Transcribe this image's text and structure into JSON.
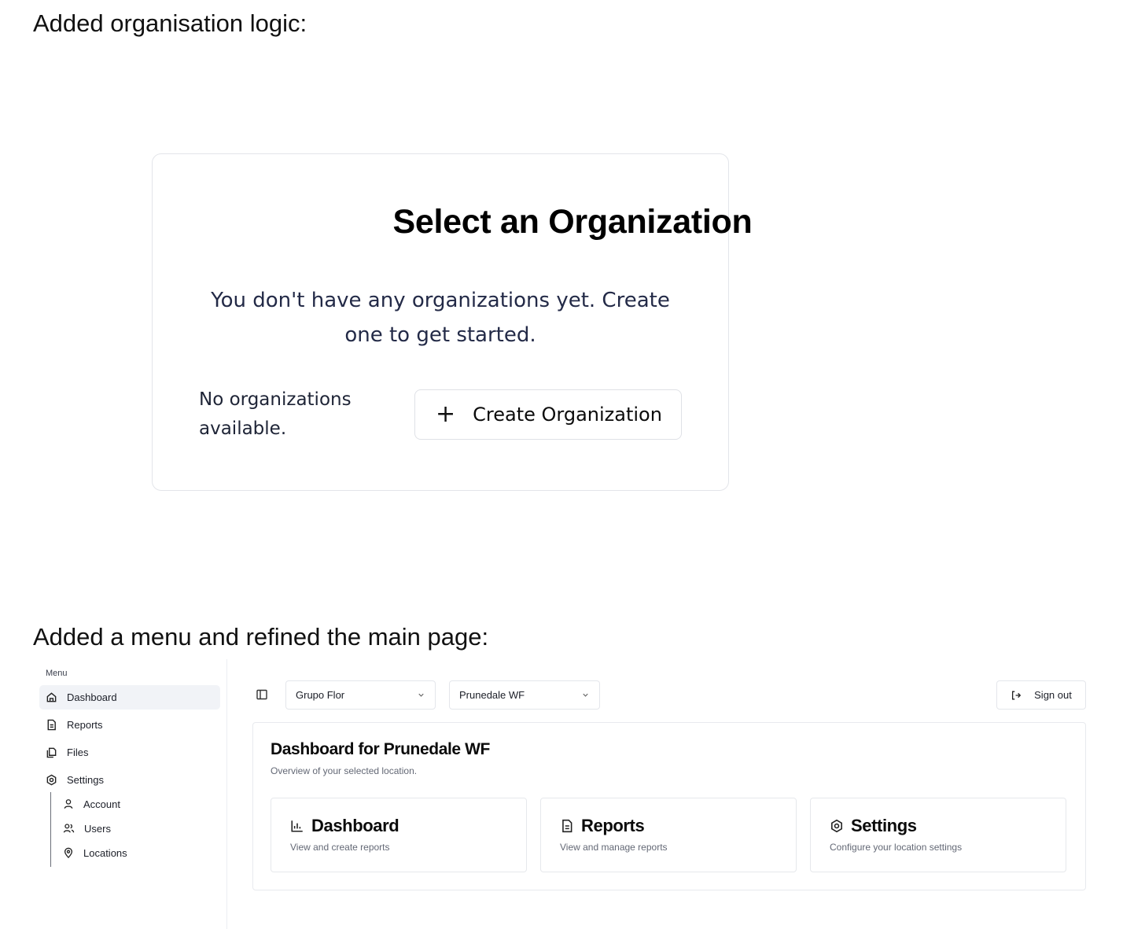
{
  "captions": {
    "first": "Added organisation logic:",
    "second": "Added a menu and refined the main page:"
  },
  "org_selector": {
    "title": "Select an Organization",
    "description": "You don't have any organizations yet. Create one to get started.",
    "empty_message": "No organizations available.",
    "create_button_label": "Create Organization",
    "create_button_icon": "plus-icon"
  },
  "app": {
    "sidebar": {
      "heading": "Menu",
      "items": [
        {
          "label": "Dashboard",
          "icon": "home-icon",
          "active": true
        },
        {
          "label": "Reports",
          "icon": "file-icon",
          "active": false
        },
        {
          "label": "Files",
          "icon": "files-icon",
          "active": false
        },
        {
          "label": "Settings",
          "icon": "gear-icon",
          "active": false
        }
      ],
      "settings_children": [
        {
          "label": "Account",
          "icon": "user-icon"
        },
        {
          "label": "Users",
          "icon": "users-icon"
        },
        {
          "label": "Locations",
          "icon": "map-pin-icon"
        }
      ]
    },
    "topbar": {
      "organization_select_value": "Grupo Flor",
      "location_select_value": "Prunedale WF",
      "sign_out_label": "Sign out"
    },
    "main": {
      "title": "Dashboard for Prunedale WF",
      "subtitle": "Overview of your selected location.",
      "cards": [
        {
          "title": "Dashboard",
          "description": "View and create reports",
          "icon": "chart-icon"
        },
        {
          "title": "Reports",
          "description": "View and manage reports",
          "icon": "file-icon"
        },
        {
          "title": "Settings",
          "description": "Configure your location settings",
          "icon": "gear-icon"
        }
      ]
    }
  },
  "colors": {
    "card_border": "#e3e5ea",
    "description_text": "#232a47",
    "active_nav_bg": "#f1f3f7",
    "muted_text": "#636875"
  }
}
